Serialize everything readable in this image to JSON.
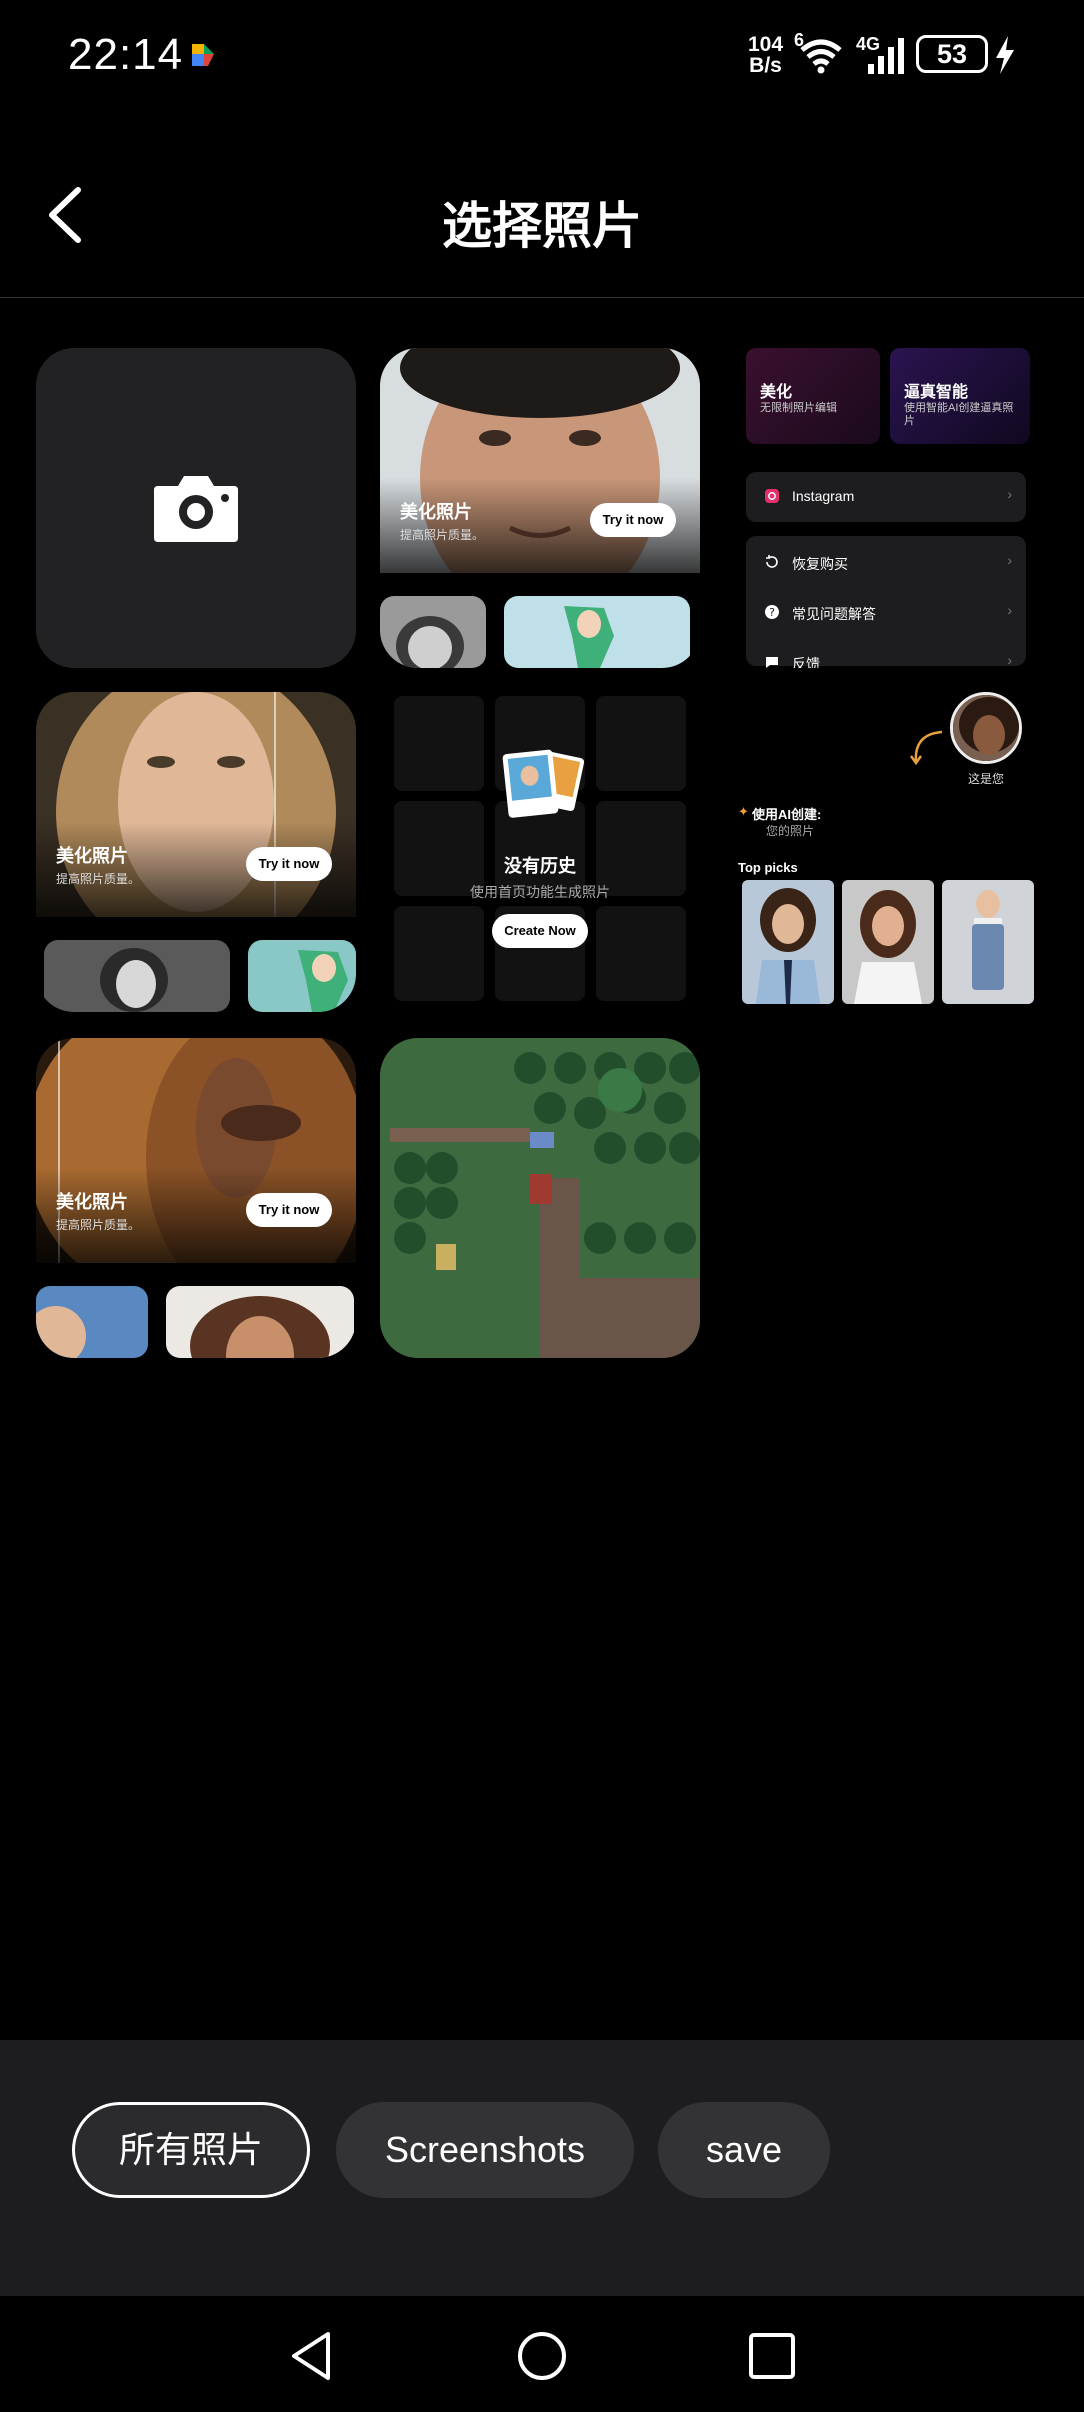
{
  "status": {
    "time": "22:14",
    "net_speed_value": "104",
    "net_speed_unit": "B/s",
    "wifi_badge": "6",
    "cell_type": "4G",
    "battery": "53"
  },
  "header": {
    "title": "选择照片"
  },
  "promo": {
    "label": "美化照片",
    "sub": "提高照片质量。",
    "button": "Try it now"
  },
  "history": {
    "title": "没有历史",
    "sub": "使用首页功能生成照片",
    "button": "Create Now"
  },
  "screenshot_preview": {
    "card1_title": "美化",
    "card1_sub": "无限制照片编辑",
    "card2_title": "逼真智能",
    "card2_sub": "使用智能AI创建逼真照片",
    "instagram": "Instagram",
    "restore": "恢复购买",
    "faq": "常见问题解答",
    "feedback": "反馈",
    "this_is_you": "这是您",
    "create_title": "使用AI创建:",
    "create_sub": "您的照片",
    "top_picks": "Top picks"
  },
  "albums": [
    {
      "label": "所有照片",
      "active": true
    },
    {
      "label": "Screenshots",
      "active": false
    },
    {
      "label": "save",
      "active": false
    }
  ],
  "colors": {
    "background": "#000000",
    "tile": "#222224",
    "chip": "#333335",
    "album_bar": "#1d1d1f"
  }
}
